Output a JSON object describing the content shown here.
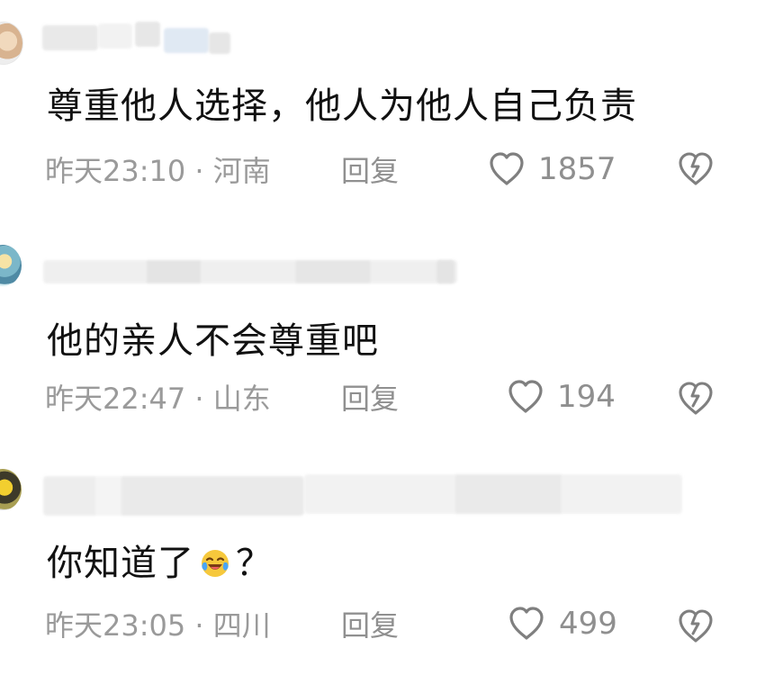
{
  "comments": [
    {
      "text": "尊重他人选择，他人为他人自己负责",
      "meta": "昨天23:10 · 河南",
      "reply_label": "回复",
      "likes": "1857"
    },
    {
      "text": "他的亲人不会尊重吧",
      "meta": "昨天22:47 · 山东",
      "reply_label": "回复",
      "likes": "194"
    },
    {
      "text_before": "你知道了",
      "emoji_name": "laughing-face-emoji",
      "text_after": "？",
      "meta": "昨天23:05 · 四川",
      "reply_label": "回复",
      "likes": "499"
    }
  ],
  "icons": {
    "like": "heart-outline-icon",
    "dislike": "broken-heart-icon"
  },
  "colors": {
    "text_primary": "#111111",
    "text_secondary": "#9a9a9a",
    "icon": "#7f7f7f",
    "emoji_face": "#f6c83c",
    "emoji_tear": "#4aa5f5"
  }
}
